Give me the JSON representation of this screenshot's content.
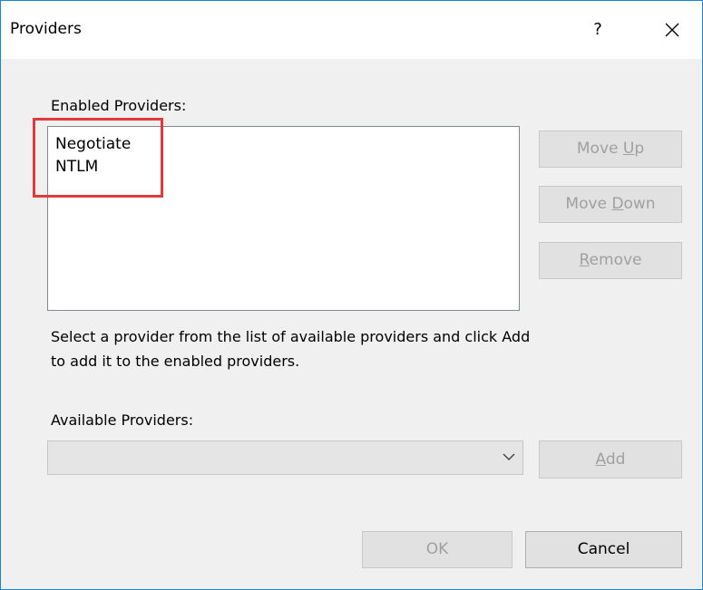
{
  "window": {
    "title": "Providers",
    "help_glyph": "?",
    "close_glyph": "✕"
  },
  "enabled": {
    "label": "Enabled Providers:",
    "items": [
      "Negotiate",
      "NTLM"
    ]
  },
  "buttons": {
    "move_up": {
      "pre": "Move ",
      "accel": "U",
      "post": "p"
    },
    "move_down": {
      "pre": "Move ",
      "accel": "D",
      "post": "own"
    },
    "remove": {
      "pre": "",
      "accel": "R",
      "post": "emove"
    },
    "add": {
      "pre": "",
      "accel": "A",
      "post": "dd"
    },
    "ok": "OK",
    "cancel": "Cancel"
  },
  "description": {
    "line1": "Select a provider from the list of available providers and click Add",
    "line2": "to add it to the enabled providers."
  },
  "available": {
    "label": "Available Providers:",
    "selected": ""
  },
  "colors": {
    "highlight": "#e0393e",
    "window_border": "#1883d7"
  },
  "icons": {
    "combo_arrow": "chevron-down-icon",
    "close": "close-icon",
    "help": "help-icon"
  }
}
